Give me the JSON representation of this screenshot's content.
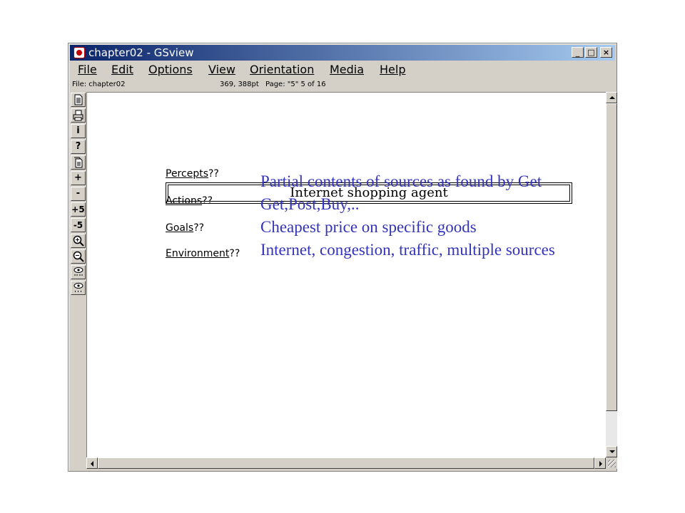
{
  "window": {
    "title": "chapter02 - GSview",
    "controls": {
      "minimize": "_",
      "maximize": "□",
      "close": "×"
    }
  },
  "menu": [
    {
      "label": "File"
    },
    {
      "label": "Edit"
    },
    {
      "label": "Options"
    },
    {
      "label": "View"
    },
    {
      "label": "Orientation"
    },
    {
      "label": "Media"
    },
    {
      "label": "Help"
    }
  ],
  "status": {
    "file": "File: chapter02",
    "coords": "369, 388pt",
    "page": "Page: \"5\"  5 of 16"
  },
  "toolbar": [
    {
      "name": "open-icon",
      "label": ""
    },
    {
      "name": "print-icon",
      "label": ""
    },
    {
      "name": "info-icon",
      "label": "i"
    },
    {
      "name": "help-icon",
      "label": "?"
    },
    {
      "name": "goto-page-icon",
      "label": ""
    },
    {
      "name": "next-page-icon",
      "label": "+"
    },
    {
      "name": "prev-page-icon",
      "label": "-"
    },
    {
      "name": "skip-forward-icon",
      "label": "+5"
    },
    {
      "name": "skip-back-icon",
      "label": "-5"
    },
    {
      "name": "zoom-in-icon",
      "label": ""
    },
    {
      "name": "zoom-out-icon",
      "label": ""
    },
    {
      "name": "find-icon",
      "label": ""
    },
    {
      "name": "find-next-icon",
      "label": ""
    }
  ],
  "slide": {
    "title": "Internet shopping agent",
    "rows": [
      {
        "label": "Percepts",
        "suffix": "??",
        "answer": "Partial contents of sources as found by Get"
      },
      {
        "label": "Actions",
        "suffix": "??",
        "answer": "Get,Post,Buy,.."
      },
      {
        "label": "Goals",
        "suffix": "??",
        "answer": "Cheapest price on specific goods"
      },
      {
        "label": "Environment",
        "suffix": "??",
        "answer": "Internet, congestion, traffic, multiple sources"
      }
    ]
  },
  "colors": {
    "titlebar_start": "#0a246a",
    "titlebar_end": "#a6caf0",
    "answer_text": "#3333bb",
    "chrome": "#d4d0c8"
  }
}
